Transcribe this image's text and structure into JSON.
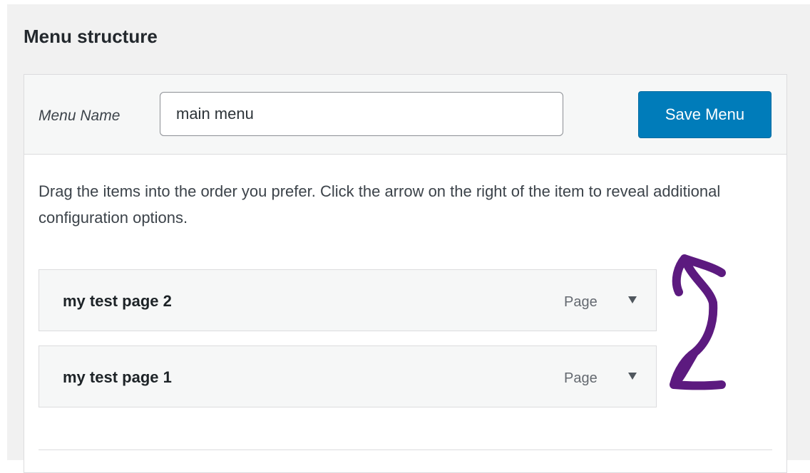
{
  "section": {
    "title": "Menu structure"
  },
  "header": {
    "menu_name_label": "Menu Name",
    "menu_name_value": "main menu",
    "save_label": "Save Menu"
  },
  "instructions": "Drag the items into the order you prefer. Click the arrow on the right of the item to reveal additional configuration options.",
  "menu_items": [
    {
      "title": "my test page 2",
      "type": "Page"
    },
    {
      "title": "my test page 1",
      "type": "Page"
    }
  ],
  "colors": {
    "accent": "#007cba",
    "annotation": "#5c1a7f"
  },
  "icons": {
    "item_toggle": "triangle-down-icon",
    "annotation": "swap-arrows-icon"
  }
}
